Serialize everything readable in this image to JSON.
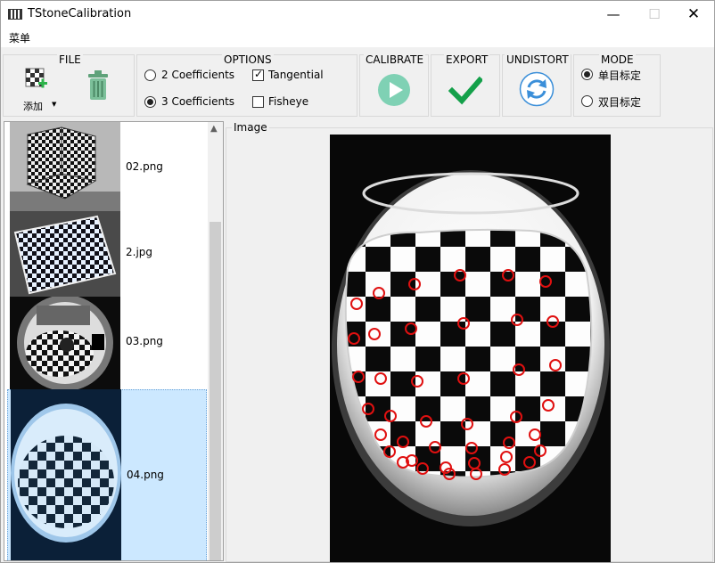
{
  "window": {
    "title": "TStoneCalibration",
    "minimize_glyph": "—",
    "maximize_glyph": "☐",
    "close_glyph": "✕"
  },
  "menu": {
    "items": [
      "菜单"
    ]
  },
  "toolbar": {
    "file": {
      "title": "FILE",
      "add_label": "添加",
      "add_dropdown_glyph": "▼",
      "add_icon": "add-image-icon",
      "delete_icon": "trash-icon"
    },
    "options": {
      "title": "OPTIONS",
      "coeff2": {
        "label": "2 Coefficients",
        "checked": false
      },
      "coeff3": {
        "label": "3 Coefficients",
        "checked": true
      },
      "tangential": {
        "label": "Tangential",
        "checked": true
      },
      "fisheye": {
        "label": "Fisheye",
        "checked": false
      }
    },
    "calibrate": {
      "title": "CALIBRATE",
      "icon": "play-icon",
      "color": "#7fd1b4"
    },
    "export": {
      "title": "EXPORT",
      "icon": "checkmark-icon",
      "color": "#14a04a"
    },
    "undistort": {
      "title": "UNDISTORT",
      "icon": "refresh-icon",
      "color": "#3b8fd9"
    },
    "mode": {
      "title": "MODE",
      "mono": {
        "label": "单目标定",
        "checked": true
      },
      "stereo": {
        "label": "双目标定",
        "checked": false
      }
    }
  },
  "image_list": {
    "items": [
      {
        "label": "02.png",
        "selected": false
      },
      {
        "label": "2.jpg",
        "selected": false
      },
      {
        "label": "03.png",
        "selected": false
      },
      {
        "label": "04.png",
        "selected": true
      }
    ],
    "scroll_up_glyph": "▲"
  },
  "image_view": {
    "title": "Image",
    "marker_color": "#e01010"
  }
}
